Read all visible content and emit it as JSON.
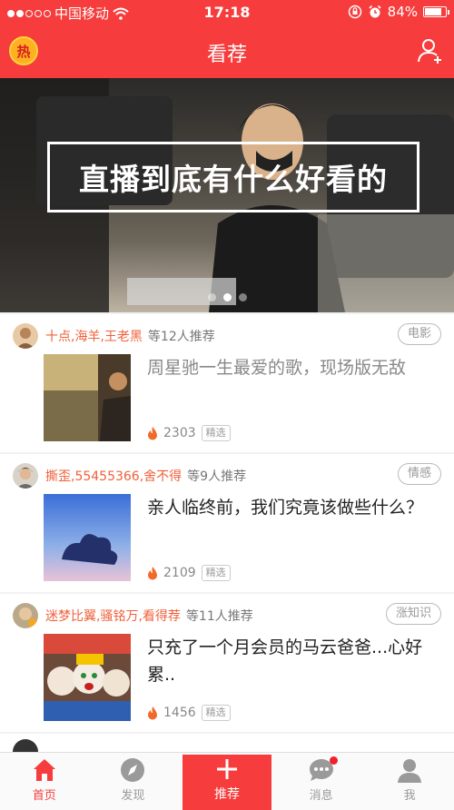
{
  "status_bar": {
    "carrier": "中国移动",
    "time": "17:18",
    "battery": "84%",
    "battery_level": 0.84
  },
  "header": {
    "badge": "热",
    "title": "看荐"
  },
  "banner": {
    "title": "直播到底有什么好看的",
    "pages": 3,
    "active_page": 1
  },
  "feed": [
    {
      "recommenders": "十点,海羊,王老黑",
      "recommend_count": "等12人推荐",
      "tag": "电影",
      "title": "周星驰一生最爱的歌，现场版无敌",
      "count": "2303",
      "pick": "精选",
      "read": true
    },
    {
      "recommenders": "撕歪,55455366,舍不得",
      "recommend_count": "等9人推荐",
      "tag": "情感",
      "title": "亲人临终前，我们究竟该做些什么？",
      "count": "2109",
      "pick": "精选",
      "read": false
    },
    {
      "recommenders": "迷梦比翼,骚铭万,看得荐",
      "recommend_count": "等11人推荐",
      "tag": "涨知识",
      "title": "只充了一个月会员的马云爸爸...心好累..",
      "count": "1456",
      "pick": "精选",
      "read": false
    }
  ],
  "tabs": [
    {
      "label": "首页",
      "icon": "home-icon",
      "active": true
    },
    {
      "label": "发现",
      "icon": "compass-icon",
      "active": false
    },
    {
      "label": "推荐",
      "icon": "plus-icon",
      "active": false
    },
    {
      "label": "消息",
      "icon": "chat-bubble-icon",
      "active": false,
      "badge": true
    },
    {
      "label": "我",
      "icon": "profile-icon",
      "active": false
    }
  ],
  "colors": {
    "brand": "#f63c3c",
    "recommender": "#f0603a",
    "flame": "#f26a2a"
  }
}
